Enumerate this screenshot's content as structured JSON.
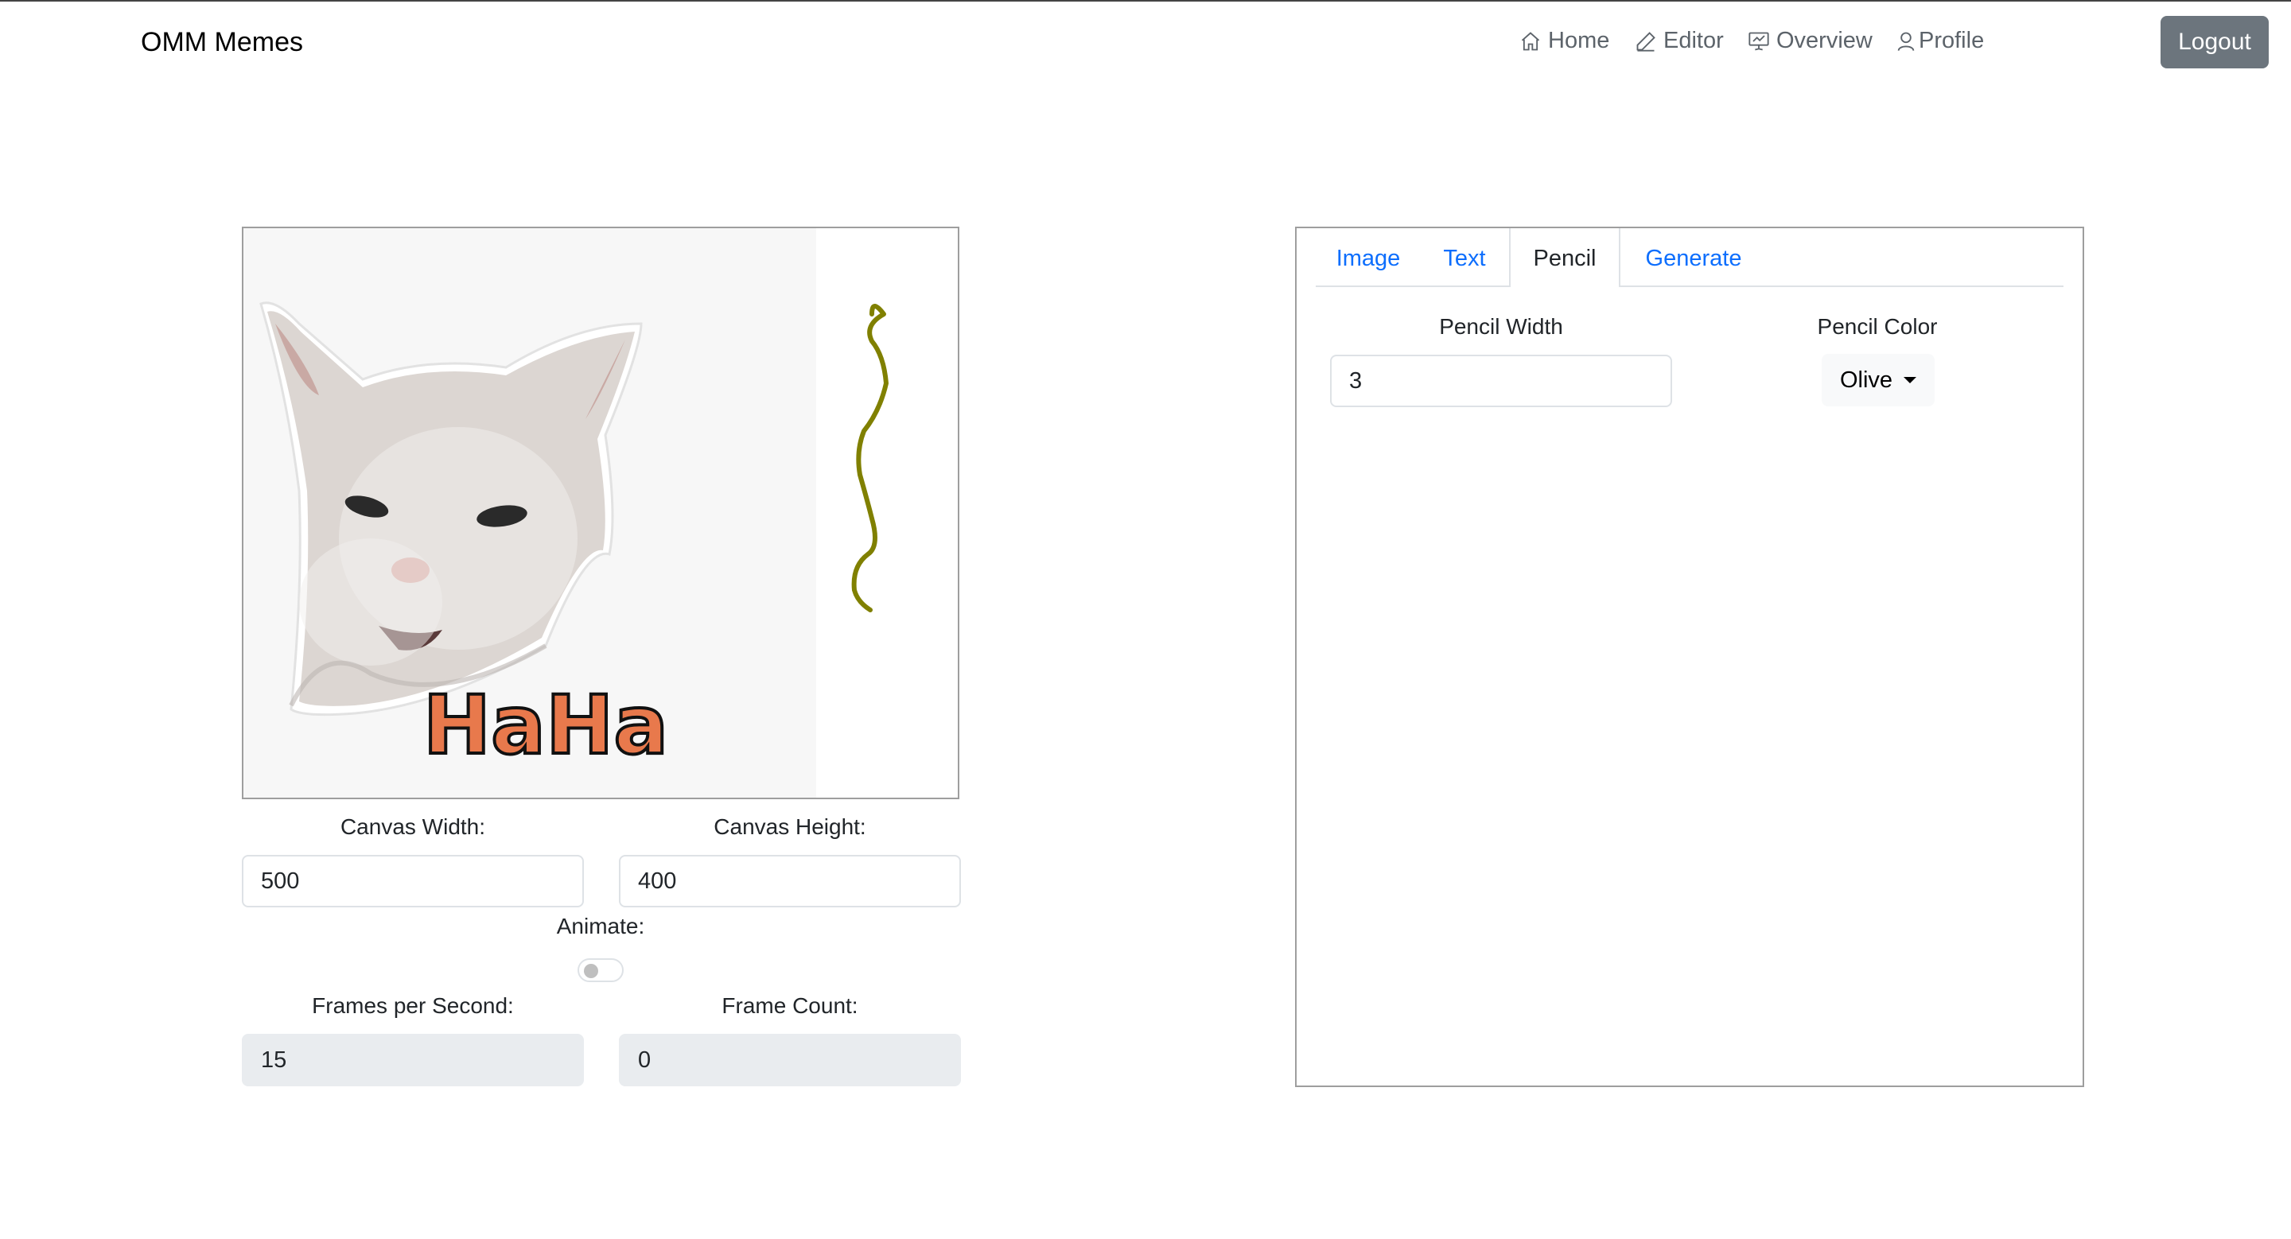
{
  "navbar": {
    "brand": "OMM Memes",
    "items": [
      {
        "label": "Home",
        "icon": "home-icon"
      },
      {
        "label": "Editor",
        "icon": "pencil-icon"
      },
      {
        "label": "Overview",
        "icon": "presentation-icon"
      },
      {
        "label": "Profile",
        "icon": "person-icon"
      }
    ],
    "logout_label": "Logout"
  },
  "canvas": {
    "meme_text": "HaHa",
    "pencil_stroke_color": "#808000"
  },
  "settings": {
    "width_label": "Canvas Width:",
    "width_value": "500",
    "height_label": "Canvas Height:",
    "height_value": "400",
    "animate_label": "Animate:",
    "animate_on": false,
    "fps_label": "Frames per Second:",
    "fps_value": "15",
    "frame_count_label": "Frame Count:",
    "frame_count_value": "0"
  },
  "tools": {
    "tabs": [
      {
        "label": "Image",
        "active": false
      },
      {
        "label": "Text",
        "active": false
      },
      {
        "label": "Pencil",
        "active": true
      },
      {
        "label": "Generate",
        "active": false
      }
    ],
    "pencil_width_label": "Pencil Width",
    "pencil_width_value": "3",
    "pencil_color_label": "Pencil Color",
    "pencil_color_value": "Olive"
  },
  "colors": {
    "link": "#0d6efd",
    "logout_bg": "#6c757d",
    "meme_text_fill": "#e8794c",
    "olive": "#808000"
  }
}
